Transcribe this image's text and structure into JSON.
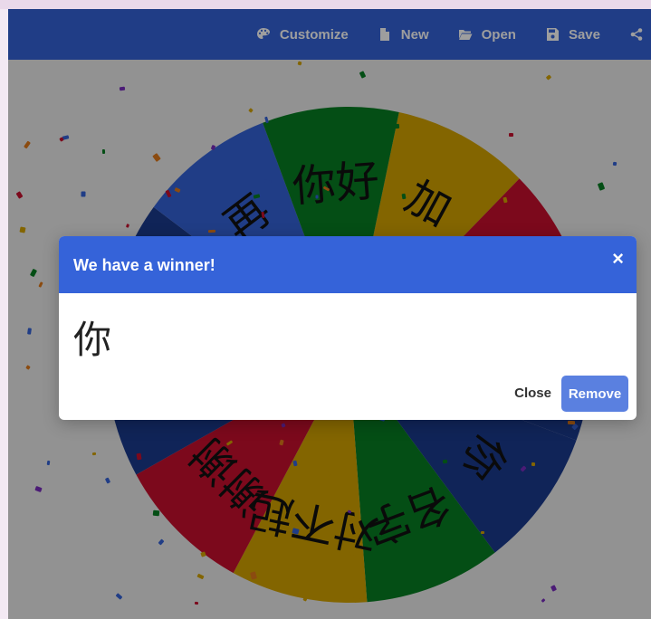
{
  "toolbar": {
    "buttons": [
      {
        "label": "Customize",
        "icon": "palette-icon"
      },
      {
        "label": "New",
        "icon": "file-icon"
      },
      {
        "label": "Open",
        "icon": "folder-open-icon"
      },
      {
        "label": "Save",
        "icon": "floppy-disk-icon"
      },
      {
        "label": "",
        "icon": "share-icon"
      }
    ]
  },
  "wheel": {
    "slices": [
      {
        "label": "加",
        "color": "#d4a300"
      },
      {
        "label": "",
        "color": "#c8102e"
      },
      {
        "label": "",
        "color": "#1b3a8f"
      },
      {
        "label": "你",
        "color": "#1b3a8f"
      },
      {
        "label": "名字",
        "color": "#087f23"
      },
      {
        "label": "对不起",
        "color": "#d4a300"
      },
      {
        "label": "谢谢",
        "color": "#c8102e"
      },
      {
        "label": "",
        "color": "#1b3a8f"
      },
      {
        "label": "",
        "color": "#1b3a8f"
      },
      {
        "label": "再",
        "color": "#3563d9"
      },
      {
        "label": "你好",
        "color": "#087f23"
      }
    ]
  },
  "modal": {
    "title": "We have a winner!",
    "close_x": "×",
    "winner": "你",
    "close_label": "Close",
    "remove_label": "Remove"
  }
}
